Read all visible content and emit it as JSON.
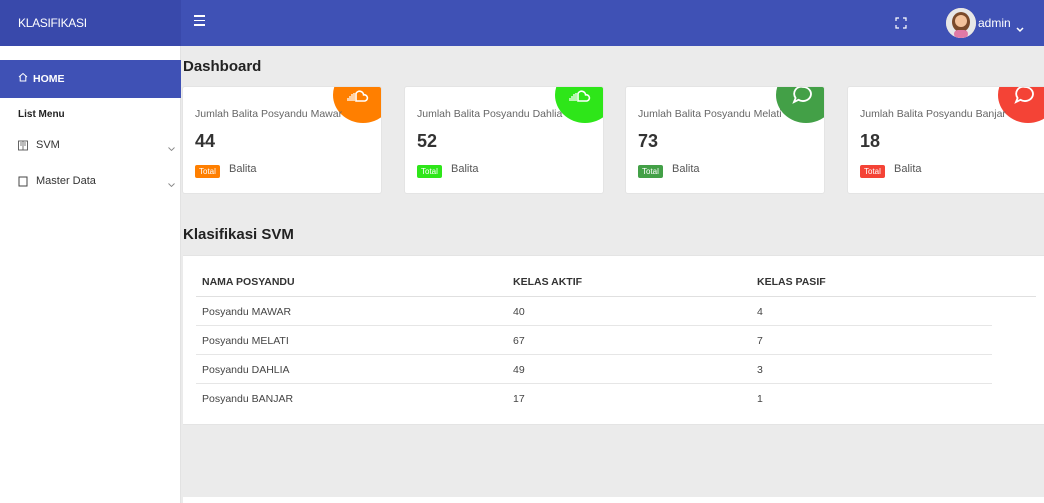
{
  "app": {
    "brand": "KLASIFIKASI"
  },
  "header": {
    "user_name": "admin"
  },
  "sidebar": {
    "home_label": "HOME",
    "section_label": "List Menu",
    "items": [
      {
        "label": "SVM",
        "icon": "book-icon"
      },
      {
        "label": "Master Data",
        "icon": "square-icon"
      }
    ]
  },
  "dashboard": {
    "title": "Dashboard",
    "cards": [
      {
        "title": "Jumlah Balita Posyandu Mawar",
        "value": "44",
        "tag": "Total",
        "unit": "Balita",
        "color": "#ff7f00",
        "icon": "soundcloud-icon"
      },
      {
        "title": "Jumlah Balita Posyandu Dahlia",
        "value": "52",
        "tag": "Total",
        "unit": "Balita",
        "color": "#2ee619",
        "icon": "soundcloud-icon"
      },
      {
        "title": "Jumlah Balita Posyandu Melati",
        "value": "73",
        "tag": "Total",
        "unit": "Balita",
        "color": "#43a047",
        "icon": "chat-icon"
      },
      {
        "title": "Jumlah Balita Posyandu Banjar",
        "value": "18",
        "tag": "Total",
        "unit": "Balita",
        "color": "#f44336",
        "icon": "chat-icon"
      }
    ]
  },
  "svm": {
    "title": "Klasifikasi SVM",
    "columns": [
      "NAMA POSYANDU",
      "KELAS AKTIF",
      "KELAS PASIF"
    ],
    "rows": [
      [
        "Posyandu MAWAR",
        "40",
        "4"
      ],
      [
        "Posyandu MELATI",
        "67",
        "7"
      ],
      [
        "Posyandu DAHLIA",
        "49",
        "3"
      ],
      [
        "Posyandu BANJAR",
        "17",
        "1"
      ]
    ]
  }
}
